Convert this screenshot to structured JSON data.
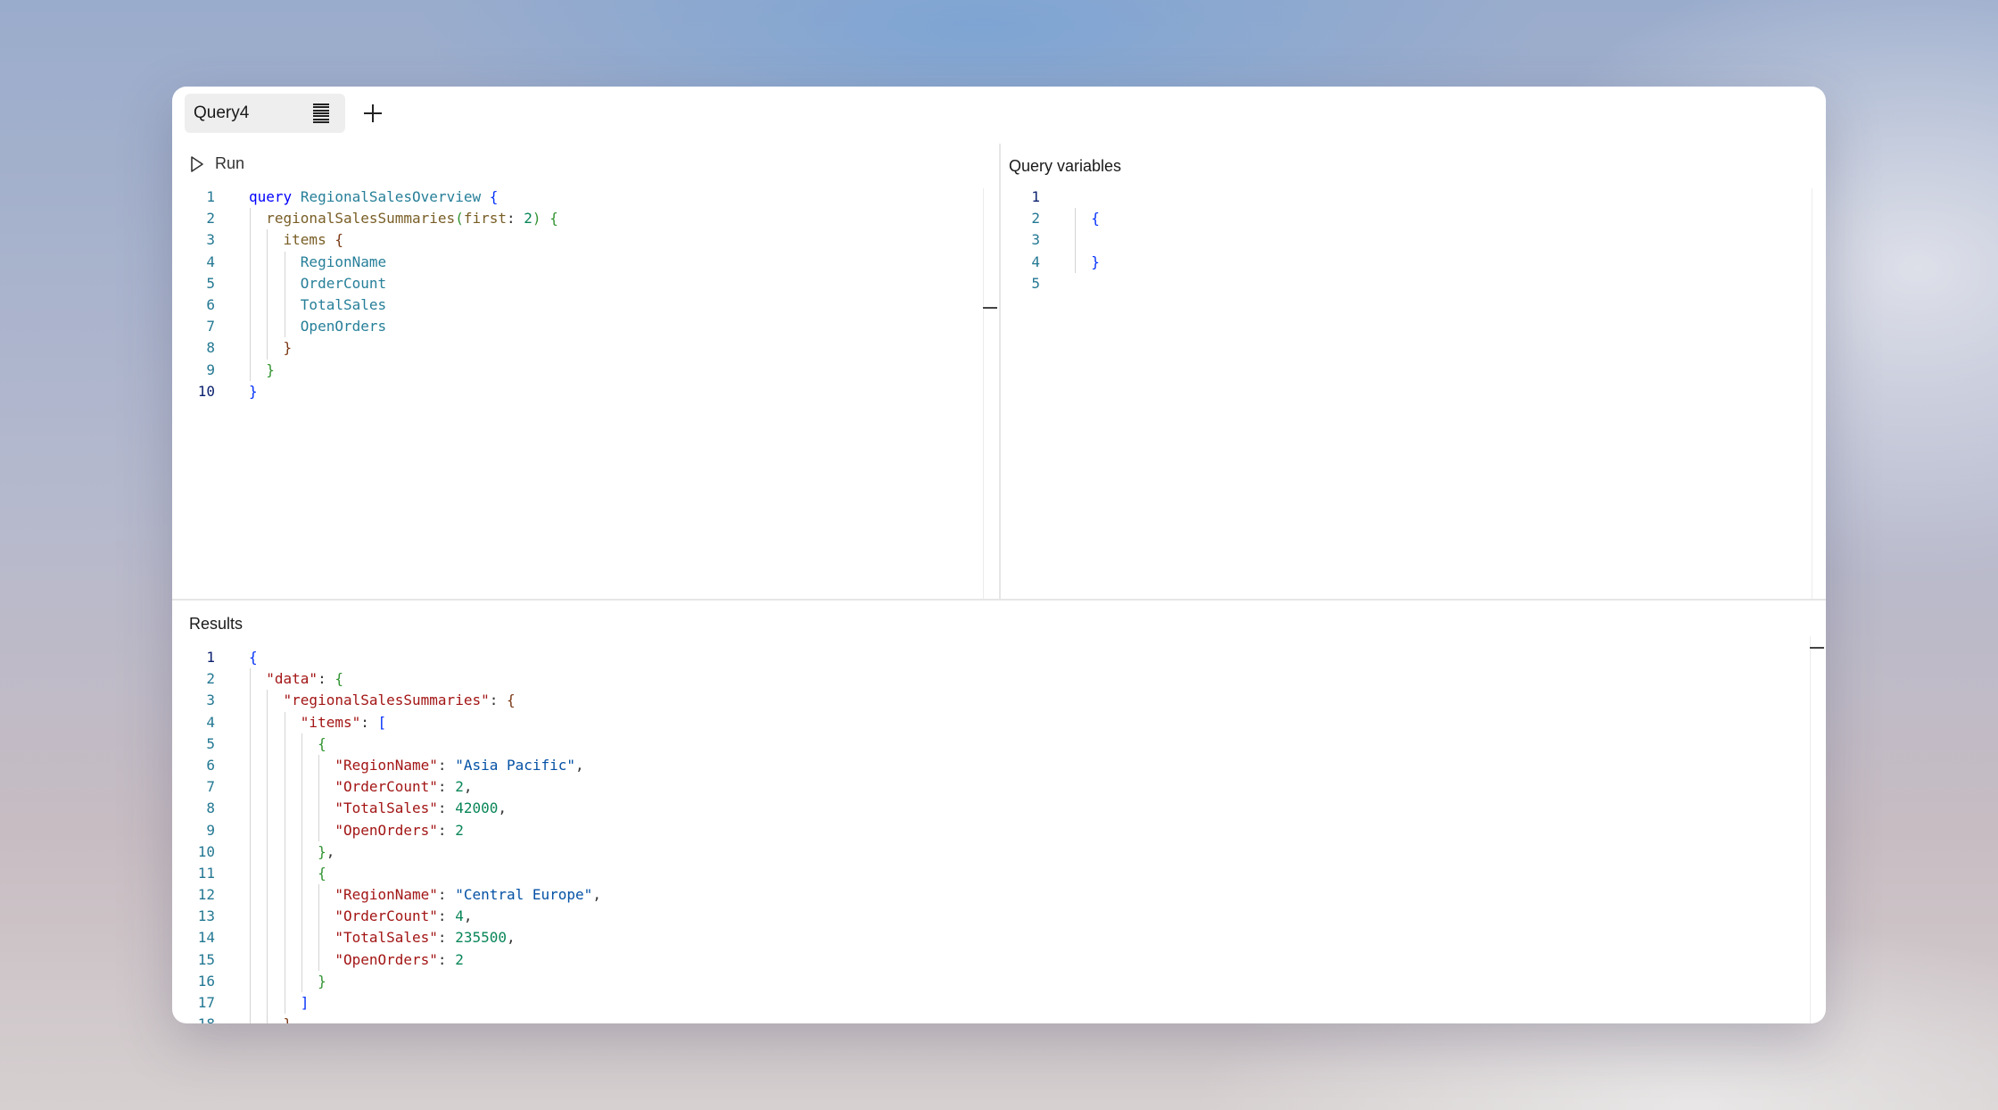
{
  "tab": {
    "label": "Query4",
    "icon": "document-lines-icon"
  },
  "add_tab_icon": "plus-icon",
  "toolbar": {
    "run_label": "Run",
    "run_icon": "play-icon"
  },
  "variables": {
    "title": "Query variables"
  },
  "results": {
    "title": "Results"
  },
  "colors": {
    "keyword": "#0000ff",
    "type": "#267f99",
    "json_key": "#a31515",
    "json_string": "#0451a5",
    "number": "#098658"
  },
  "query_lines": [
    [
      [
        "query",
        "kw"
      ],
      [
        " ",
        "pun"
      ],
      [
        "RegionalSalesOverview",
        "fn"
      ],
      [
        " ",
        "pun"
      ],
      [
        "{",
        "br1"
      ]
    ],
    [
      [
        "  ",
        "pun"
      ],
      [
        "regionalSalesSummaries",
        "op"
      ],
      [
        "(",
        "br2"
      ],
      [
        "first",
        "op"
      ],
      [
        ": ",
        "pun"
      ],
      [
        "2",
        "num"
      ],
      [
        ")",
        "br2"
      ],
      [
        " ",
        "pun"
      ],
      [
        "{",
        "br2"
      ]
    ],
    [
      [
        "    ",
        "pun"
      ],
      [
        "items",
        "op"
      ],
      [
        " ",
        "pun"
      ],
      [
        "{",
        "br3"
      ]
    ],
    [
      [
        "      ",
        "pun"
      ],
      [
        "RegionName",
        "fld"
      ]
    ],
    [
      [
        "      ",
        "pun"
      ],
      [
        "OrderCount",
        "fld"
      ]
    ],
    [
      [
        "      ",
        "pun"
      ],
      [
        "TotalSales",
        "fld"
      ]
    ],
    [
      [
        "      ",
        "pun"
      ],
      [
        "OpenOrders",
        "fld"
      ]
    ],
    [
      [
        "    ",
        "pun"
      ],
      [
        "}",
        "br3"
      ]
    ],
    [
      [
        "  ",
        "pun"
      ],
      [
        "}",
        "br2"
      ]
    ],
    [
      [
        "}",
        "br1"
      ]
    ]
  ],
  "variable_lines": [
    [],
    [
      [
        "  ",
        "pun"
      ],
      [
        "{",
        "br1"
      ]
    ],
    [],
    [
      [
        "  ",
        "pun"
      ],
      [
        "}",
        "br1"
      ]
    ],
    []
  ],
  "result_lines": [
    [
      [
        "{",
        "br1"
      ]
    ],
    [
      [
        "  ",
        "pun"
      ],
      [
        "\"data\"",
        "key"
      ],
      [
        ": ",
        "pun"
      ],
      [
        "{",
        "br2"
      ]
    ],
    [
      [
        "    ",
        "pun"
      ],
      [
        "\"regionalSalesSummaries\"",
        "key"
      ],
      [
        ": ",
        "pun"
      ],
      [
        "{",
        "br3"
      ]
    ],
    [
      [
        "      ",
        "pun"
      ],
      [
        "\"items\"",
        "key"
      ],
      [
        ": ",
        "pun"
      ],
      [
        "[",
        "br1"
      ]
    ],
    [
      [
        "        ",
        "pun"
      ],
      [
        "{",
        "br2"
      ]
    ],
    [
      [
        "          ",
        "pun"
      ],
      [
        "\"RegionName\"",
        "key"
      ],
      [
        ": ",
        "pun"
      ],
      [
        "\"Asia Pacific\"",
        "str"
      ],
      [
        ",",
        "pun"
      ]
    ],
    [
      [
        "          ",
        "pun"
      ],
      [
        "\"OrderCount\"",
        "key"
      ],
      [
        ": ",
        "pun"
      ],
      [
        "2",
        "num"
      ],
      [
        ",",
        "pun"
      ]
    ],
    [
      [
        "          ",
        "pun"
      ],
      [
        "\"TotalSales\"",
        "key"
      ],
      [
        ": ",
        "pun"
      ],
      [
        "42000",
        "num"
      ],
      [
        ",",
        "pun"
      ]
    ],
    [
      [
        "          ",
        "pun"
      ],
      [
        "\"OpenOrders\"",
        "key"
      ],
      [
        ": ",
        "pun"
      ],
      [
        "2",
        "num"
      ]
    ],
    [
      [
        "        ",
        "pun"
      ],
      [
        "}",
        "br2"
      ],
      [
        ",",
        "pun"
      ]
    ],
    [
      [
        "        ",
        "pun"
      ],
      [
        "{",
        "br2"
      ]
    ],
    [
      [
        "          ",
        "pun"
      ],
      [
        "\"RegionName\"",
        "key"
      ],
      [
        ": ",
        "pun"
      ],
      [
        "\"Central Europe\"",
        "str"
      ],
      [
        ",",
        "pun"
      ]
    ],
    [
      [
        "          ",
        "pun"
      ],
      [
        "\"OrderCount\"",
        "key"
      ],
      [
        ": ",
        "pun"
      ],
      [
        "4",
        "num"
      ],
      [
        ",",
        "pun"
      ]
    ],
    [
      [
        "          ",
        "pun"
      ],
      [
        "\"TotalSales\"",
        "key"
      ],
      [
        ": ",
        "pun"
      ],
      [
        "235500",
        "num"
      ],
      [
        ",",
        "pun"
      ]
    ],
    [
      [
        "          ",
        "pun"
      ],
      [
        "\"OpenOrders\"",
        "key"
      ],
      [
        ": ",
        "pun"
      ],
      [
        "2",
        "num"
      ]
    ],
    [
      [
        "        ",
        "pun"
      ],
      [
        "}",
        "br2"
      ]
    ],
    [
      [
        "      ",
        "pun"
      ],
      [
        "]",
        "br1"
      ]
    ],
    [
      [
        "    ",
        "pun"
      ],
      [
        "}",
        "br3"
      ]
    ],
    [
      [
        "  ",
        "pun"
      ],
      [
        "}",
        "br2"
      ]
    ],
    [
      [
        "}",
        "br1"
      ]
    ]
  ]
}
